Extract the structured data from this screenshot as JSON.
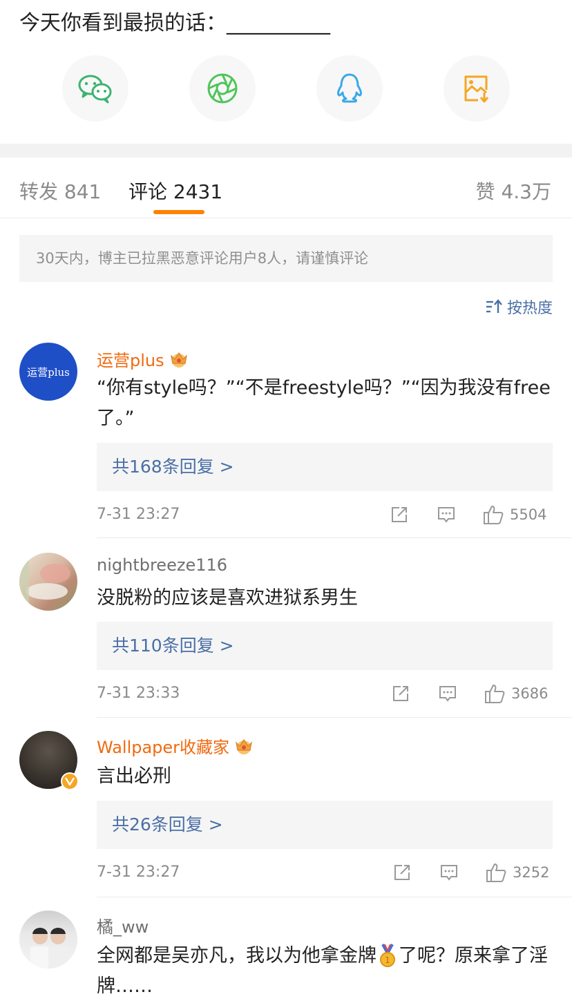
{
  "post": {
    "title": "今天你看到最损的话：__________"
  },
  "share": {
    "items": [
      {
        "icon": "wechat-icon",
        "color": "#3cb371"
      },
      {
        "icon": "moments-icon",
        "color": "#4fc55a"
      },
      {
        "icon": "qq-icon",
        "color": "#3aa8e8"
      },
      {
        "icon": "save-image-icon",
        "color": "#f5a623"
      }
    ]
  },
  "tabs": {
    "repost": "转发 841",
    "comment": "评论 2431",
    "like": "赞 4.3万",
    "active_color": "#ff8200"
  },
  "notice": "30天内，博主已拉黑恶意评论用户8人，请谨慎评论",
  "sort": {
    "label": "按热度"
  },
  "comments": [
    {
      "author": "运营plus",
      "avatar_text": "运营plus",
      "text": "“你有style吗？”“不是freestyle吗？”“因为我没有free了。”",
      "replies": "共168条回复 >",
      "time": "7-31 23:27",
      "likes": "5504"
    },
    {
      "author": "nightbreeze116",
      "text": "没脱粉的应该是喜欢进狱系男生",
      "replies": "共110条回复 >",
      "time": "7-31 23:33",
      "likes": "3686"
    },
    {
      "author": "Wallpaper收藏家",
      "text": "言出必刑",
      "replies": "共26条回复 >",
      "time": "7-31 23:27",
      "likes": "3252"
    },
    {
      "author": "橘_ww",
      "text_before": "全网都是吴亦凡，我以为他拿金牌",
      "text_after": "了呢？原来拿了淫牌……"
    }
  ],
  "colors": {
    "link": "#4a6fa5",
    "author_vip": "#f06a0f",
    "muted": "#8a8a8a"
  }
}
